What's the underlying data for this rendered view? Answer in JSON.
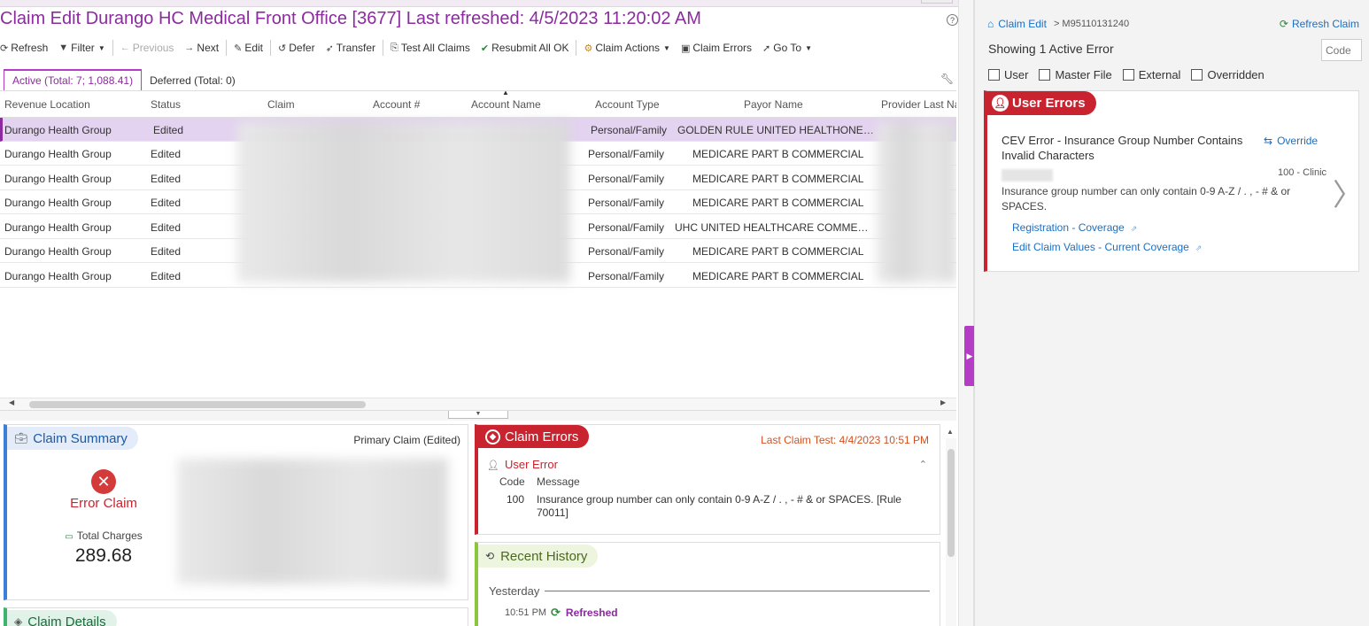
{
  "header": {
    "title": "Claim Edit Durango HC Medical Front Office [3677] Last refreshed: 4/5/2023 11:20:02 AM",
    "help_icon": "?"
  },
  "toolbar": {
    "refresh": "Refresh",
    "filter": "Filter",
    "previous": "Previous",
    "next": "Next",
    "edit": "Edit",
    "defer": "Defer",
    "transfer": "Transfer",
    "test_all": "Test All Claims",
    "resubmit": "Resubmit All OK",
    "claim_actions": "Claim Actions",
    "claim_errors": "Claim Errors",
    "go_to": "Go To"
  },
  "tabs": {
    "active": "Active (Total: 7; 1,088.41)",
    "deferred": "Deferred (Total: 0)"
  },
  "grid": {
    "columns": [
      "Revenue Location",
      "Status",
      "Claim",
      "Account #",
      "Account Name",
      "Account Type",
      "Payor Name",
      "Provider Last Na"
    ],
    "rows": [
      {
        "location": "Durango Health Group",
        "status": "Edited",
        "type": "Personal/Family",
        "payor": "GOLDEN RULE UNITED HEALTHONE C..."
      },
      {
        "location": "Durango Health Group",
        "status": "Edited",
        "type": "Personal/Family",
        "payor": "MEDICARE PART B COMMERCIAL"
      },
      {
        "location": "Durango Health Group",
        "status": "Edited",
        "type": "Personal/Family",
        "payor": "MEDICARE PART B COMMERCIAL"
      },
      {
        "location": "Durango Health Group",
        "status": "Edited",
        "type": "Personal/Family",
        "payor": "MEDICARE PART B COMMERCIAL"
      },
      {
        "location": "Durango Health Group",
        "status": "Edited",
        "type": "Personal/Family",
        "payor": "UHC UNITED HEALTHCARE COMMERC..."
      },
      {
        "location": "Durango Health Group",
        "status": "Edited",
        "type": "Personal/Family",
        "payor": "MEDICARE PART B COMMERCIAL"
      },
      {
        "location": "Durango Health Group",
        "status": "Edited",
        "type": "Personal/Family",
        "payor": "MEDICARE PART B COMMERCIAL"
      }
    ]
  },
  "summary": {
    "title": "Claim Summary",
    "claim_type": "Primary Claim (Edited)",
    "status": "Error Claim",
    "charges_label": "Total Charges",
    "charges_value": "289.68"
  },
  "details": {
    "title": "Claim Details"
  },
  "claim_errors": {
    "title": "Claim Errors",
    "last_test": "Last Claim Test: 4/4/2023 10:51 PM",
    "section": "User Error",
    "col_code": "Code",
    "col_message": "Message",
    "code": "100",
    "message": "Insurance group number can only contain 0-9 A-Z / . , - # & or SPACES. [Rule 70011]"
  },
  "history": {
    "title": "Recent History",
    "group": "Yesterday",
    "time": "10:51 PM",
    "event": "Refreshed"
  },
  "right": {
    "crumb_home": "Claim Edit",
    "crumb_id": "> M95110131240",
    "refresh_claim": "Refresh Claim",
    "showing": "Showing 1 Active Error",
    "code_placeholder": "Code",
    "filters": [
      "User",
      "Master File",
      "External",
      "Overridden"
    ],
    "user_errors_title": "User Errors",
    "error_title": "CEV Error - Insurance Group Number Contains Invalid Characters",
    "override": "Override",
    "error_code": "100 - Clinic",
    "error_message": "Insurance group number can only contain 0-9 A-Z / . , - # & or SPACES.",
    "link1": "Registration - Coverage",
    "link2": "Edit Claim Values - Current Coverage"
  },
  "colors": {
    "accent": "#8c2aa0",
    "error": "#c8232f",
    "link": "#1b6fc4"
  }
}
